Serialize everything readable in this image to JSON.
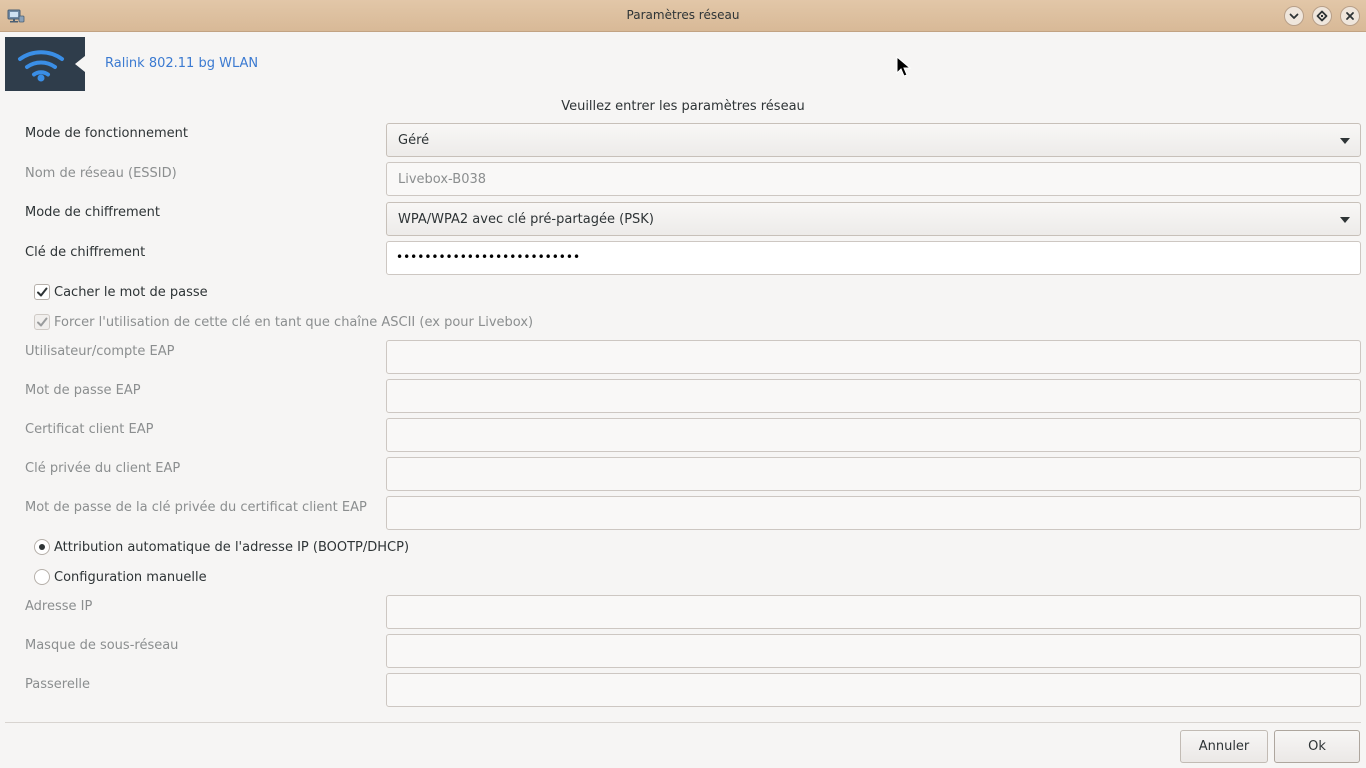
{
  "window": {
    "title": "Paramètres réseau"
  },
  "header": {
    "device_name": "Ralink 802.11 bg WLAN",
    "instructions": "Veuillez entrer les paramètres réseau"
  },
  "form": {
    "mode_label": "Mode de fonctionnement",
    "mode_value": "Géré",
    "essid_label": "Nom de réseau (ESSID)",
    "essid_value": "Livebox-B038",
    "encryption_mode_label": "Mode de chiffrement",
    "encryption_mode_value": "WPA/WPA2 avec clé pré-partagée (PSK)",
    "encryption_key_label": "Clé de chiffrement",
    "encryption_key_masked": "••••••••••••••••••••••••••",
    "hide_password_label": "Cacher le mot de passe",
    "hide_password_checked": true,
    "force_ascii_label": "Forcer l'utilisation de cette clé en tant que chaîne ASCII (ex pour Livebox)",
    "force_ascii_checked": true,
    "eap_user_label": "Utilisateur/compte EAP",
    "eap_user_value": "",
    "eap_password_label": "Mot de passe EAP",
    "eap_password_value": "",
    "eap_client_cert_label": "Certificat client EAP",
    "eap_client_cert_value": "",
    "eap_client_key_label": "Clé privée du client EAP",
    "eap_client_key_value": "",
    "eap_key_password_label": "Mot de passe de la clé privée du certificat client EAP",
    "eap_key_password_value": "",
    "dhcp_label": "Attribution automatique de l'adresse IP (BOOTP/DHCP)",
    "dhcp_selected": true,
    "manual_label": "Configuration manuelle",
    "manual_selected": false,
    "ip_label": "Adresse IP",
    "ip_value": "",
    "netmask_label": "Masque de sous-réseau",
    "netmask_value": "",
    "gateway_label": "Passerelle",
    "gateway_value": ""
  },
  "buttons": {
    "cancel_label": "Annuler",
    "ok_label": "Ok"
  },
  "colors": {
    "titlebar": "#dcbc9c",
    "link": "#3b7ad1",
    "icon_bg": "#2f3d4b",
    "wifi_icon": "#3a8ee6"
  }
}
